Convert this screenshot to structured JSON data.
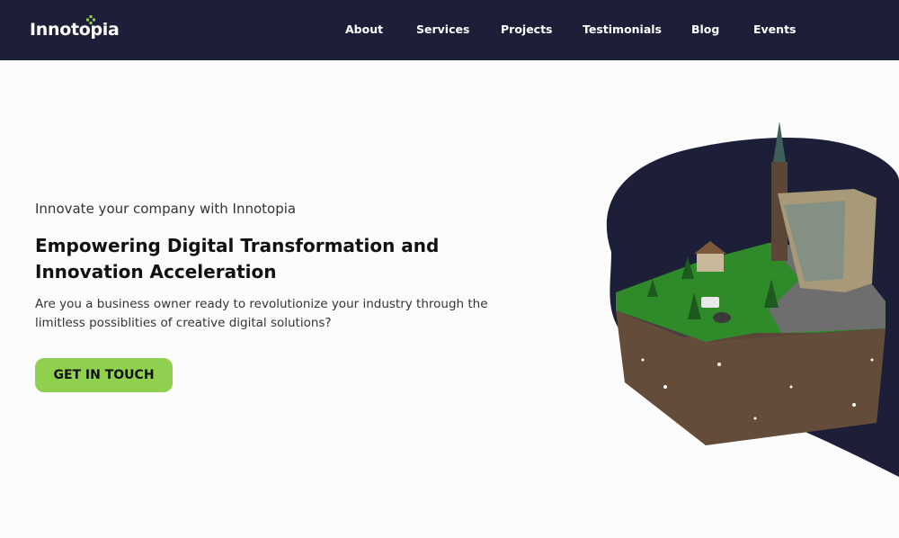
{
  "brand": {
    "name": "Innotopia"
  },
  "nav": {
    "items": [
      {
        "label": "About"
      },
      {
        "label": "Services"
      },
      {
        "label": "Projects"
      },
      {
        "label": "Testimonials"
      },
      {
        "label": "Blog"
      },
      {
        "label": "Events"
      }
    ]
  },
  "hero": {
    "eyebrow": "Innovate your company with Innotopia",
    "headline_line1": "Empowering Digital Transformation and",
    "headline_line2": "Innovation Acceleration",
    "lede_line1": "Are you a business owner ready to revolutionize your industry through the",
    "lede_line2": "limitless possiblities of creative digital solutions?",
    "cta_label": "GET IN TOUCH"
  },
  "colors": {
    "navbar_bg": "#1d1f38",
    "accent_green": "#8fd14f",
    "page_bg": "#fcfcfc",
    "blob": "#1d1f38"
  }
}
